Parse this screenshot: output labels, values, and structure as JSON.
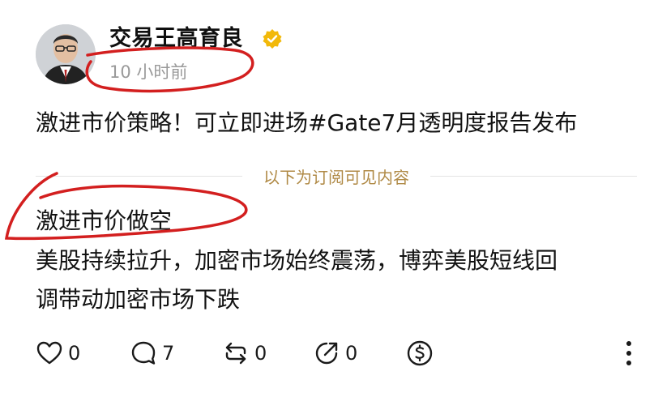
{
  "post": {
    "author": "交易王高育良",
    "time": "10 小时前",
    "headline": "激进市价策略！可立即进场#Gate7月透明度报告发布",
    "divider_label": "以下为订阅可见内容",
    "subhead": "激进市价做空",
    "body_lines": [
      "美股持续拉升，加密市场始终震荡，博弈美股短线回",
      "调带动加密市场下跌"
    ]
  },
  "actions": {
    "like": {
      "icon": "heart-icon",
      "count": "0"
    },
    "comment": {
      "icon": "comment-icon",
      "count": "7"
    },
    "repost": {
      "icon": "repost-icon",
      "count": "0"
    },
    "share": {
      "icon": "share-icon",
      "count": "0"
    },
    "tip": {
      "icon": "dollar-coin-icon"
    },
    "more": {
      "icon": "more-vertical-icon"
    }
  },
  "colors": {
    "verified_badge": "#f2b90a",
    "divider_label": "#b08a46",
    "annotation_stroke": "#d31f1f",
    "secondary_text": "#9a9a9a"
  }
}
